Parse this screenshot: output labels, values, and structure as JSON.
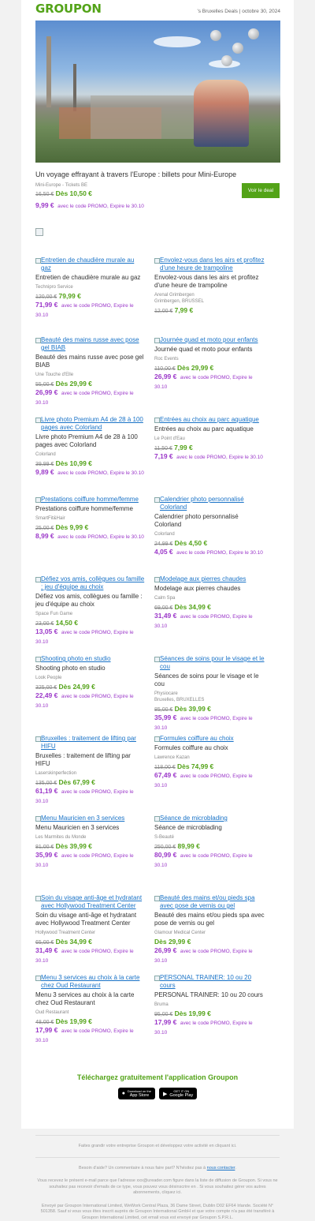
{
  "header": {
    "logo": "GROUPON",
    "meta": "'s Bruxelles Deals | octobre 30, 2024"
  },
  "hero": {
    "image_alt": "Mini-Europe",
    "title": "Un voyage effrayant à travers l'Europe : billets pour Mini-Europe",
    "subtitle": "Mini-Europe - Tickets BE",
    "old_price": "16,50 €",
    "new_price": "Dès 10,50 €",
    "promo_price": "9,99 €",
    "promo_note": "avec le code PROMO, Expire le 30.10",
    "button": "Voir le deal"
  },
  "deals": [
    {
      "alt": "Entretien de chaudière murale au gaz",
      "title": "Entretien de chaudière murale au gaz",
      "merchant": "Technipro Service",
      "old": "120,00 €",
      "new": "79,99 €",
      "promo": "71,99 €",
      "note": "avec le code PROMO, Expire le 30.10"
    },
    {
      "alt": "Envolez-vous dans les airs et profitez d'une heure de trampoline",
      "title": "Envolez-vous dans les airs et profitez d'une heure de trampoline",
      "merchant": "Arenal Grimbergen\nGrimbergen, BRUSSEL",
      "old": "12,00 €",
      "new": "7,99 €",
      "promo": "",
      "note": ""
    },
    {
      "alt": "Beauté des mains russe avec pose gel BIAB",
      "title": "Beauté des mains russe avec pose gel BIAB",
      "merchant": "Une Touche d'Elle",
      "old": "55,00 €",
      "new": "Dès 29,99 €",
      "promo": "26,99 €",
      "note": "avec le code PROMO, Expire le 30.10"
    },
    {
      "alt": "Journée quad et moto pour enfants",
      "title": "Journée quad et moto pour enfants",
      "merchant": "Roc Events",
      "old": "110,00 €",
      "new": "Dès 29,99 €",
      "promo": "26,99 €",
      "note": "avec le code PROMO, Expire le 30.10"
    },
    {
      "alt": "Livre photo Premium A4 de 28 à 100 pages avec Colorland",
      "title": "Livre photo Premium A4 de 28 à 100 pages avec Colorland",
      "merchant": "Colorland",
      "old": "39,99 €",
      "new": "Dès 10,99 €",
      "promo": "9,89 €",
      "note": "avec le code PROMO, Expire le 30.10"
    },
    {
      "alt": "Entrées au choix au parc aquatique",
      "title": "Entrées au choix au parc aquatique",
      "merchant": "Le Point d'Eau",
      "old": "11,50 €",
      "new": "7,99 €",
      "promo": "7,19 €",
      "note": "avec le code PROMO, Expire le 30.10"
    },
    {
      "alt": "Prestations coiffure homme/femme",
      "title": "Prestations coiffure homme/femme",
      "merchant": "SmartFit&Hair",
      "old": "25,00 €",
      "new": "Dès 9,99 €",
      "promo": "8,99 €",
      "note": "avec le code PROMO, Expire le 30.10"
    },
    {
      "alt": "Calendrier photo personnalisé Colorland",
      "title": "Calendrier photo personnalisé Colorland",
      "merchant": "Colorland",
      "old": "24,99 €",
      "new": "Dès 4,50 €",
      "promo": "4,05 €",
      "note": "avec le code PROMO, Expire le 30.10"
    },
    {
      "alt": "Défiez vos amis, collègues ou famille : jeu d'équipe au choix",
      "title": "Défiez vos amis, collègues ou famille : jeu d'équipe au choix",
      "merchant": "Space Fun Game",
      "old": "23,00 €",
      "new": "14,50 €",
      "promo": "13,05 €",
      "note": "avec le code PROMO, Expire le 30.10"
    },
    {
      "alt": "Modelage aux pierres chaudes",
      "title": "Modelage aux pierres chaudes",
      "merchant": "Calm Spa",
      "old": "69,00 €",
      "new": "Dès 34,99 €",
      "promo": "31,49 €",
      "note": "avec le code PROMO, Expire le 30.10"
    },
    {
      "alt": "Shooting photo en studio",
      "title": "Shooting photo en studio",
      "merchant": "Look People",
      "old": "325,00 €",
      "new": "Dès 24,99 €",
      "promo": "22,49 €",
      "note": "avec le code PROMO, Expire le 30.10"
    },
    {
      "alt": "Séances de soins pour le visage et le cou",
      "title": "Séances de soins pour le visage et le cou",
      "merchant": "Physiocare\nBruxelles, BRUXELLES",
      "old": "85,00 €",
      "new": "Dès 39,99 €",
      "promo": "35,99 €",
      "note": "avec le code PROMO, Expire le 30.10"
    },
    {
      "alt": "Bruxelles : traitement de lifting par HIFU",
      "title": "Bruxelles : traitement de lifting par HIFU",
      "merchant": "Laserskinperfection",
      "old": "135,00 €",
      "new": "Dès 67,99 €",
      "promo": "61,19 €",
      "note": "avec le code PROMO, Expire le 30.10"
    },
    {
      "alt": "Formules coiffure au choix",
      "title": "Formules coiffure au choix",
      "merchant": "Lawrence Kazan",
      "old": "118,00 €",
      "new": "Dès 74,99 €",
      "promo": "67,49 €",
      "note": "avec le code PROMO, Expire le 30.10"
    },
    {
      "alt": "Menu Mauricien en 3 services",
      "title": "Menu Mauricien en 3 services",
      "merchant": "Les Marmites du Monde",
      "old": "81,00 €",
      "new": "Dès 39,99 €",
      "promo": "35,99 €",
      "note": "avec le code PROMO, Expire le 30.10"
    },
    {
      "alt": "Séance de microblading",
      "title": "Séance de microblading",
      "merchant": "S-Beauté",
      "old": "250,00 €",
      "new": "89,99 €",
      "promo": "80,99 €",
      "note": "avec le code PROMO, Expire le 30.10"
    },
    {
      "alt": "Soin du visage anti-âge et hydratant avec Hollywood Treatment Center",
      "title": "Soin du visage anti-âge et hydratant avec Hollywood Treatment Center",
      "merchant": "Hollywood Treatment Center",
      "old": "65,00 €",
      "new": "Dès 34,99 €",
      "promo": "31,49 €",
      "note": "avec le code PROMO, Expire le 30.10"
    },
    {
      "alt": "Beauté des mains et/ou pieds spa avec pose de vernis ou gel",
      "title": "Beauté des mains et/ou pieds spa avec pose de vernis ou gel",
      "merchant": "Glamour Medical Center",
      "old": "",
      "new": "Dès 29,99 €",
      "promo": "26,99 €",
      "note": "avec le code PROMO, Expire le 30.10"
    },
    {
      "alt": "Menu 3 services au choix à la carte chez Oud Restaurant",
      "title": "Menu 3 services au choix à la carte chez Oud Restaurant",
      "merchant": "Oud Restaurant",
      "old": "48,00 €",
      "new": "Dès 19,99 €",
      "promo": "17,99 €",
      "note": "avec le code PROMO, Expire le 30.10"
    },
    {
      "alt": "PERSONAL TRAINER: 10 ou 20 cours",
      "title": "PERSONAL TRAINER: 10 ou 20 cours",
      "merchant": "Bruma",
      "old": "95,00 €",
      "new": "Dès 19,99 €",
      "promo": "17,99 €",
      "note": "avec le code PROMO, Expire le 30.10"
    }
  ],
  "app": {
    "title": "Téléchargez gratuitement l'application Groupon",
    "appstore_small": "Download on the",
    "appstore": "App Store",
    "googleplay_small": "GET IT ON",
    "googleplay": "Google Play"
  },
  "footer": {
    "line1": "Faites grandir votre entreprise Groupon et développez votre activité en cliquant ici.",
    "help_text": "Besoin d'aide? Un commentaire à nous faire part? N'hésitez pas à",
    "help_link": "nous contacter",
    "legal1": "Vous recevez le présent e-mail parce que l'adresse xxx@ureader.com figure dans la liste de diffusion de Groupon. Si vous ne souhaitez pas recevoir d'emails de ce type, vous pouvez vous désinscrire en . Si vous souhaitez gérer vos autres abonnements, cliquez ici.",
    "legal2": "Envoyé par Groupon International Limited, WeWork Central Plaza, 36 Dame Street, Dublin D02 EF64 Irlande. Société N° 501358. Sauf si vous vous êtes inscrit auprès de Groupon International GmbH et que votre compte n'a pas été transféré à Groupon International Limited, cet email vous est envoyé par Groupon S.P.R.L."
  },
  "colors": {
    "brand_green": "#53a318",
    "promo_purple": "#9b37c9",
    "link_blue": "#1a73c7"
  }
}
